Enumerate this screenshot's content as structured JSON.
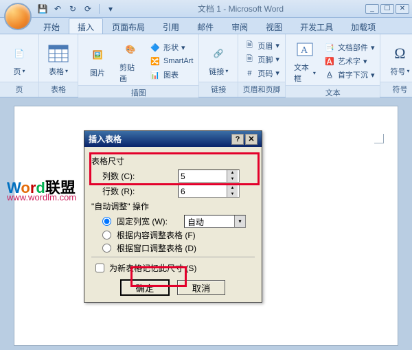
{
  "title": "文档 1 - Microsoft Word",
  "qat": {
    "save": "save-icon",
    "undo": "undo-icon",
    "redo": "redo-icon",
    "repeat": "repeat-icon"
  },
  "tabs": [
    "开始",
    "插入",
    "页面布局",
    "引用",
    "邮件",
    "审阅",
    "视图",
    "开发工具",
    "加载项"
  ],
  "active_tab": 1,
  "ribbon": {
    "groups": [
      {
        "label": "页",
        "items": [
          {
            "label": "页",
            "drop": true
          }
        ]
      },
      {
        "label": "表格",
        "items": [
          {
            "label": "表格",
            "drop": true
          }
        ]
      },
      {
        "label": "插图",
        "big": [
          {
            "label": "图片"
          },
          {
            "label": "剪贴画"
          }
        ],
        "small": [
          {
            "label": "形状",
            "drop": true
          },
          {
            "label": "SmartArt"
          },
          {
            "label": "图表"
          }
        ]
      },
      {
        "label": "链接",
        "items": [
          {
            "label": "链接",
            "drop": true
          }
        ]
      },
      {
        "label": "页眉和页脚",
        "small": [
          {
            "label": "页眉",
            "drop": true
          },
          {
            "label": "页脚",
            "drop": true
          },
          {
            "label": "页码",
            "drop": true
          }
        ]
      },
      {
        "label": "文本",
        "big": [
          {
            "label": "文本框",
            "drop": true
          }
        ],
        "small": [
          {
            "label": "文档部件",
            "drop": true
          },
          {
            "label": "艺术字",
            "drop": true
          },
          {
            "label": "首字下沉",
            "drop": true
          }
        ]
      },
      {
        "label": "符号",
        "items": [
          {
            "label": "符号",
            "drop": true
          }
        ]
      }
    ]
  },
  "dialog": {
    "title": "插入表格",
    "section_size": "表格尺寸",
    "cols_label": "列数 (C):",
    "cols_value": "5",
    "rows_label": "行数 (R):",
    "rows_value": "6",
    "section_autofit": "\"自动调整\" 操作",
    "fixed_label": "固定列宽 (W):",
    "fixed_value": "自动",
    "fit_content": "根据内容调整表格 (F)",
    "fit_window": "根据窗口调整表格 (D)",
    "remember": "为新表格记忆此尺寸 (S)",
    "ok": "确定",
    "cancel": "取消"
  },
  "watermark": {
    "text": "Word联盟",
    "url": "www.wordlm.com"
  }
}
